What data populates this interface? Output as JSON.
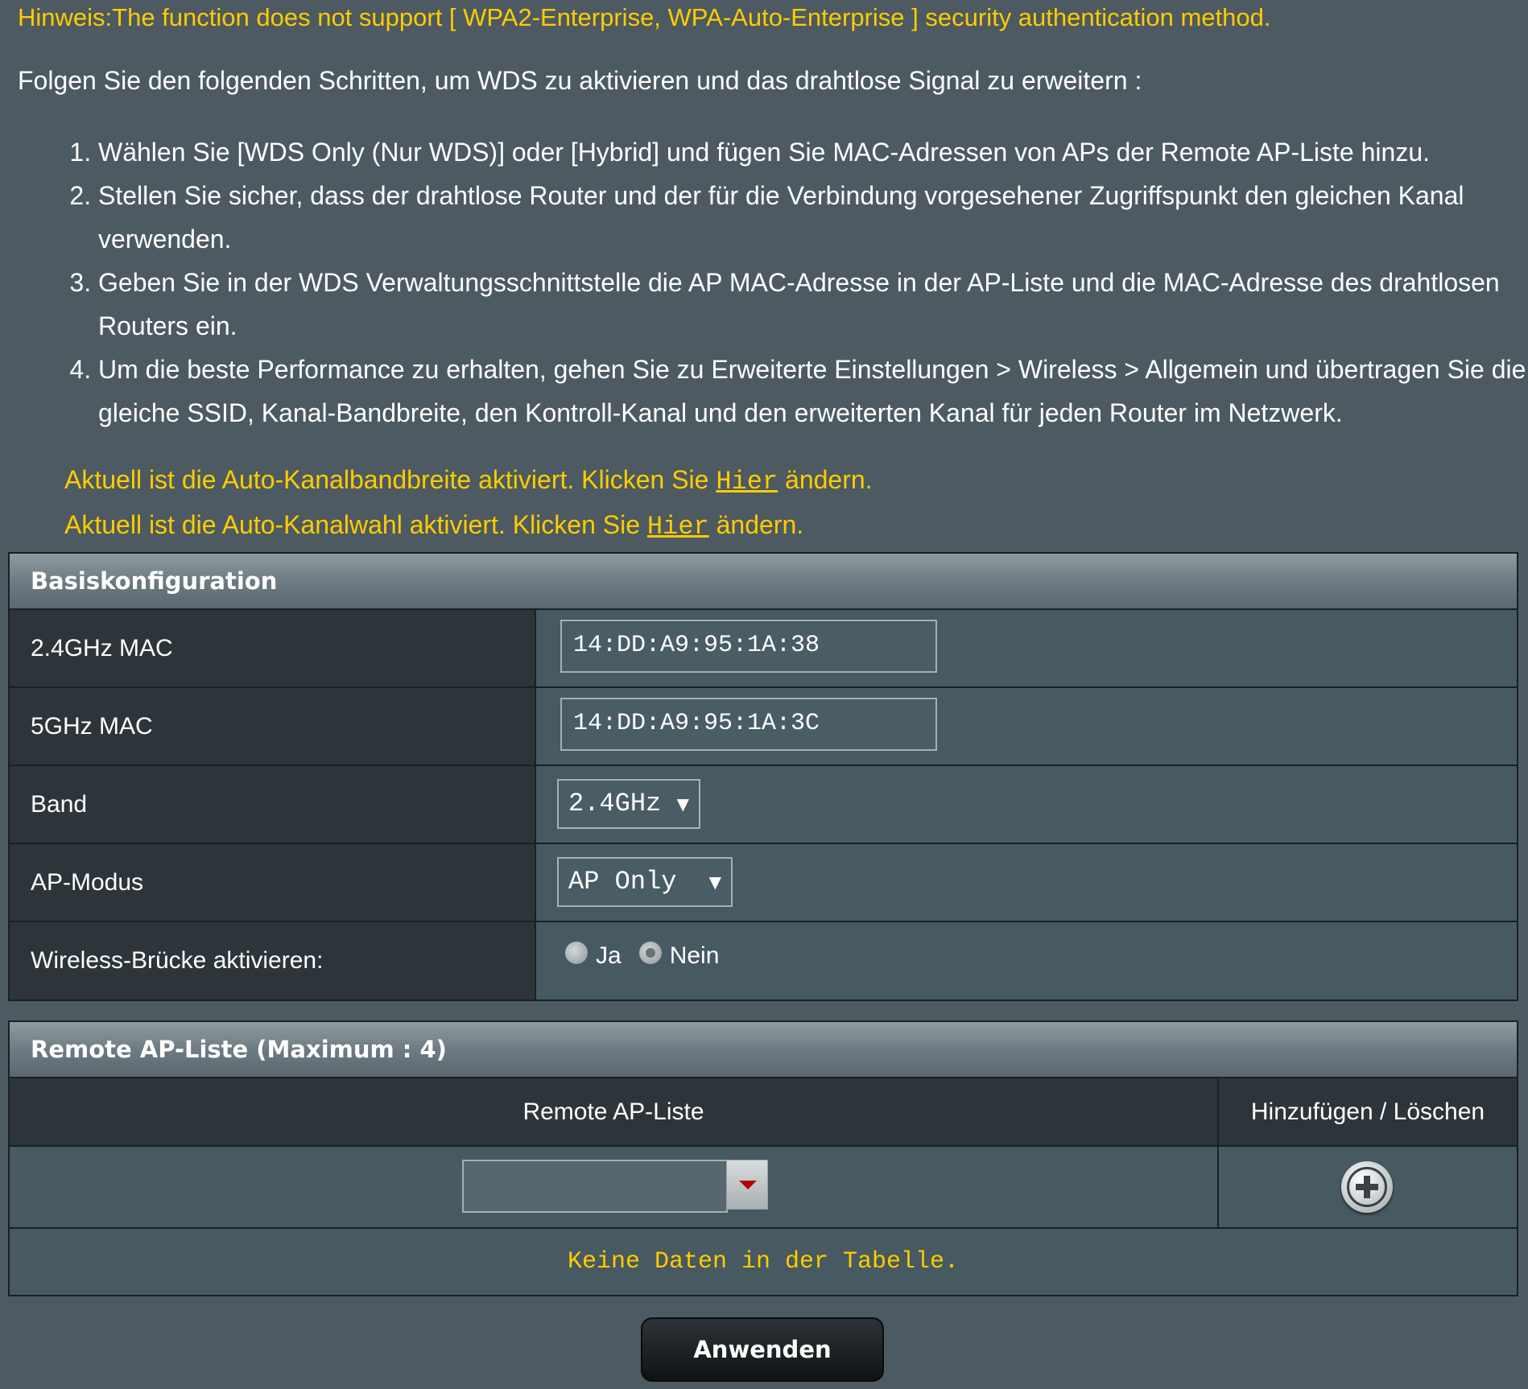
{
  "notice": "Hinweis:The function does not support [ WPA2-Enterprise, WPA-Auto-Enterprise ] security authentication method.",
  "intro": "Folgen Sie den folgenden Schritten, um WDS zu aktivieren und das drahtlose Signal zu erweitern :",
  "steps": [
    "Wählen Sie [WDS Only (Nur WDS)] oder [Hybrid] und fügen Sie MAC-Adressen von APs der Remote AP-Liste hinzu.",
    "Stellen Sie sicher, dass der drahtlose Router und der für die Verbindung vorgesehener Zugriffspunkt den gleichen Kanal verwenden.",
    "Geben Sie in der WDS Verwaltungsschnittstelle die AP MAC-Adresse in der AP-Liste und die MAC-Adresse des drahtlosen Routers ein.",
    "Um die beste Performance zu erhalten, gehen Sie zu Erweiterte Einstellungen > Wireless > Allgemein und übertragen Sie die gleiche SSID, Kanal-Bandbreite, den Kontroll-Kanal und den erweiterten Kanal für jeden Router im Netzwerk."
  ],
  "auto_bandwidth": {
    "prefix": "Aktuell ist die Auto-Kanalbandbreite aktiviert. Klicken Sie ",
    "link": "Hier",
    "suffix": " ändern."
  },
  "auto_channel": {
    "prefix": "Aktuell ist die Auto-Kanalwahl aktiviert. Klicken Sie ",
    "link": "Hier",
    "suffix": " ändern."
  },
  "basic": {
    "title": "Basiskonfiguration",
    "mac24_label": "2.4GHz MAC",
    "mac24_value": "14:DD:A9:95:1A:38",
    "mac5_label": "5GHz MAC",
    "mac5_value": "14:DD:A9:95:1A:3C",
    "band_label": "Band",
    "band_value": "2.4GHz",
    "apmode_label": "AP-Modus",
    "apmode_value": "AP Only",
    "bridge_label": "Wireless-Brücke aktivieren:",
    "bridge_yes": "Ja",
    "bridge_no": "Nein",
    "bridge_selected": "Nein"
  },
  "remote": {
    "title": "Remote AP-Liste (Maximum : 4)",
    "col_list": "Remote AP-Liste",
    "col_action": "Hinzufügen / Löschen",
    "empty": "Keine Daten in der Tabelle.",
    "input_value": ""
  },
  "apply_label": "Anwenden",
  "icons": {
    "add": "add-circle-icon",
    "dropdown": "dropdown-arrow-icon"
  },
  "colors": {
    "accent": "#ffcc00",
    "background": "#4d5a61",
    "cell": "#475961",
    "label_cell": "#2d353a"
  }
}
